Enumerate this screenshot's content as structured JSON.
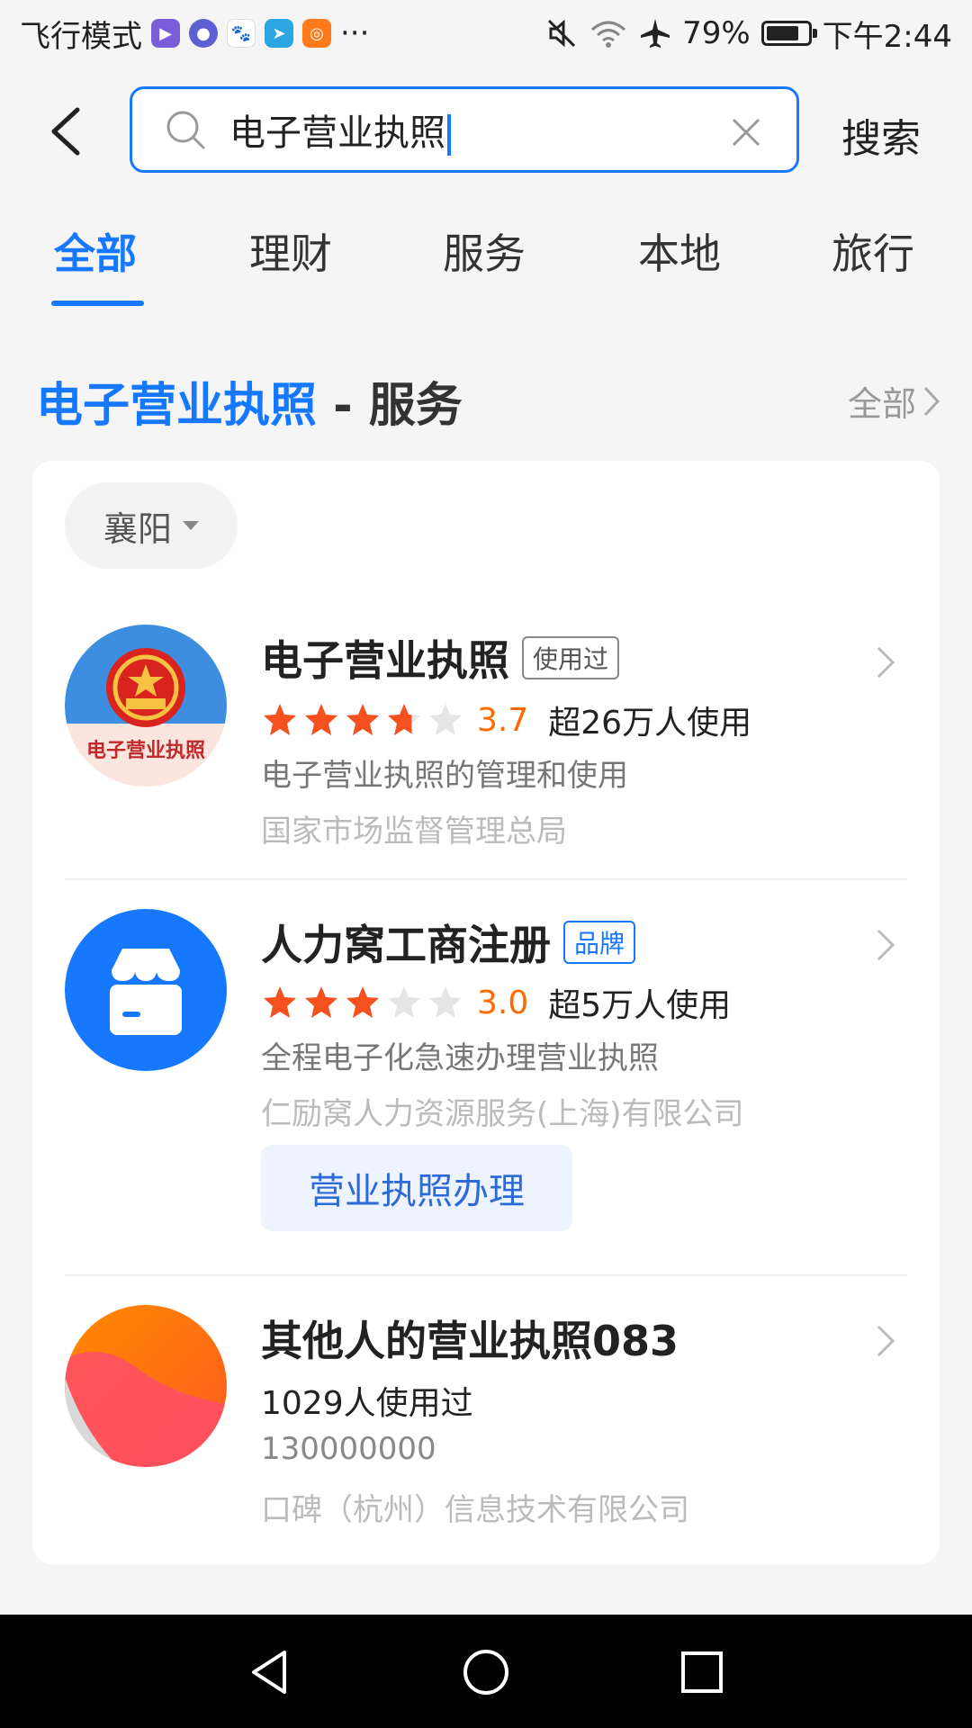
{
  "status_bar": {
    "left_text": "飞行模式",
    "dots": "···",
    "battery": "79%",
    "battery_level": 0.79,
    "time": "下午2:44",
    "icons": [
      "video-app-icon",
      "browser-app-icon",
      "baidu-app-icon",
      "telegram-app-icon",
      "kuaishou-app-icon",
      "mute-icon",
      "wifi-icon",
      "airplane-icon",
      "battery-icon"
    ]
  },
  "search": {
    "query": "电子营业执照",
    "submit_label": "搜索"
  },
  "tabs": [
    {
      "label": "全部",
      "active": true
    },
    {
      "label": "理财",
      "active": false
    },
    {
      "label": "服务",
      "active": false
    },
    {
      "label": "本地",
      "active": false
    },
    {
      "label": "旅行",
      "active": false
    }
  ],
  "section": {
    "highlight": "电子营业执照",
    "suffix": " - 服务",
    "see_all": "全部"
  },
  "filter": {
    "city": "襄阳"
  },
  "items": [
    {
      "title": "电子营业执照",
      "badge": "使用过",
      "avatar_caption": "电子营业执照",
      "rating": 3.7,
      "rating_text": "3.7",
      "usage": "超26万人使用",
      "desc": "电子营业执照的管理和使用",
      "corp": "国家市场监督管理总局"
    },
    {
      "title": "人力窝工商注册",
      "badge": "品牌",
      "rating": 3.0,
      "rating_text": "3.0",
      "usage": "超5万人使用",
      "desc": "全程电子化急速办理营业执照",
      "corp": "仁励窝人力资源服务(上海)有限公司",
      "action": "营业执照办理"
    },
    {
      "title": "其他人的营业执照083",
      "usage_count": "1029人使用过",
      "phone": "130000000",
      "corp": "口碑（杭州）信息技术有限公司"
    }
  ],
  "colors": {
    "accent": "#1677ff",
    "rating": "#ff6a00",
    "star_active": "#f4511e",
    "star_inactive": "#e5e5e5"
  }
}
